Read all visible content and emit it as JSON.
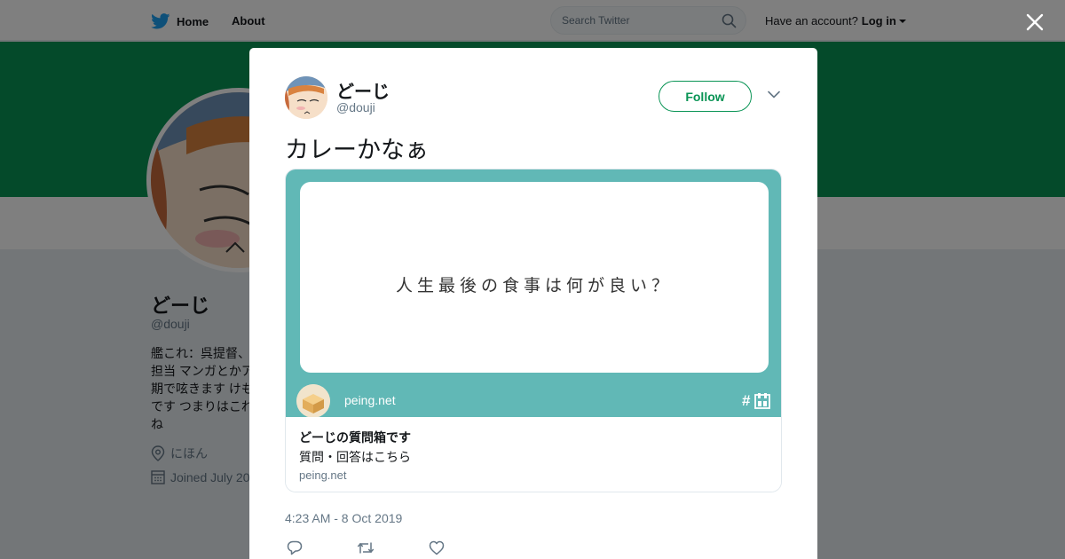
{
  "topbar": {
    "home_label": "Home",
    "about_label": "About",
    "search_placeholder": "Search Twitter",
    "have_account": "Have an account?",
    "login_label": "Log in",
    "icons": [
      "twitter-bird-icon",
      "search-icon",
      "caret-down-icon",
      "close-icon"
    ]
  },
  "profile": {
    "name": "どーじ",
    "handle": "@douji",
    "bio_lines": [
      "艦これ：呉提督、",
      "担当 マンガとかア",
      "期で呟きます けも",
      "です つまりはこれ",
      "ね"
    ],
    "location": "にほん",
    "joined": "Joined July 20",
    "colors": {
      "banner": "#099455"
    }
  },
  "tweet": {
    "name": "どーじ",
    "handle": "@douji",
    "follow_label": "Follow",
    "text": "カレーかなぁ",
    "timestamp": "4:23 AM - 8 Oct 2019",
    "card": {
      "question": "人生最後の食事は何が良い？",
      "site_label": "peing.net",
      "hash_label": "#",
      "title": "どーじの質問箱です",
      "description": "質問・回答はこちら",
      "domain": "peing.net"
    },
    "actions": [
      "reply-icon",
      "retweet-icon",
      "like-icon"
    ],
    "colors": {
      "accent": "#099455",
      "card_bg": "#61b8b6"
    }
  }
}
